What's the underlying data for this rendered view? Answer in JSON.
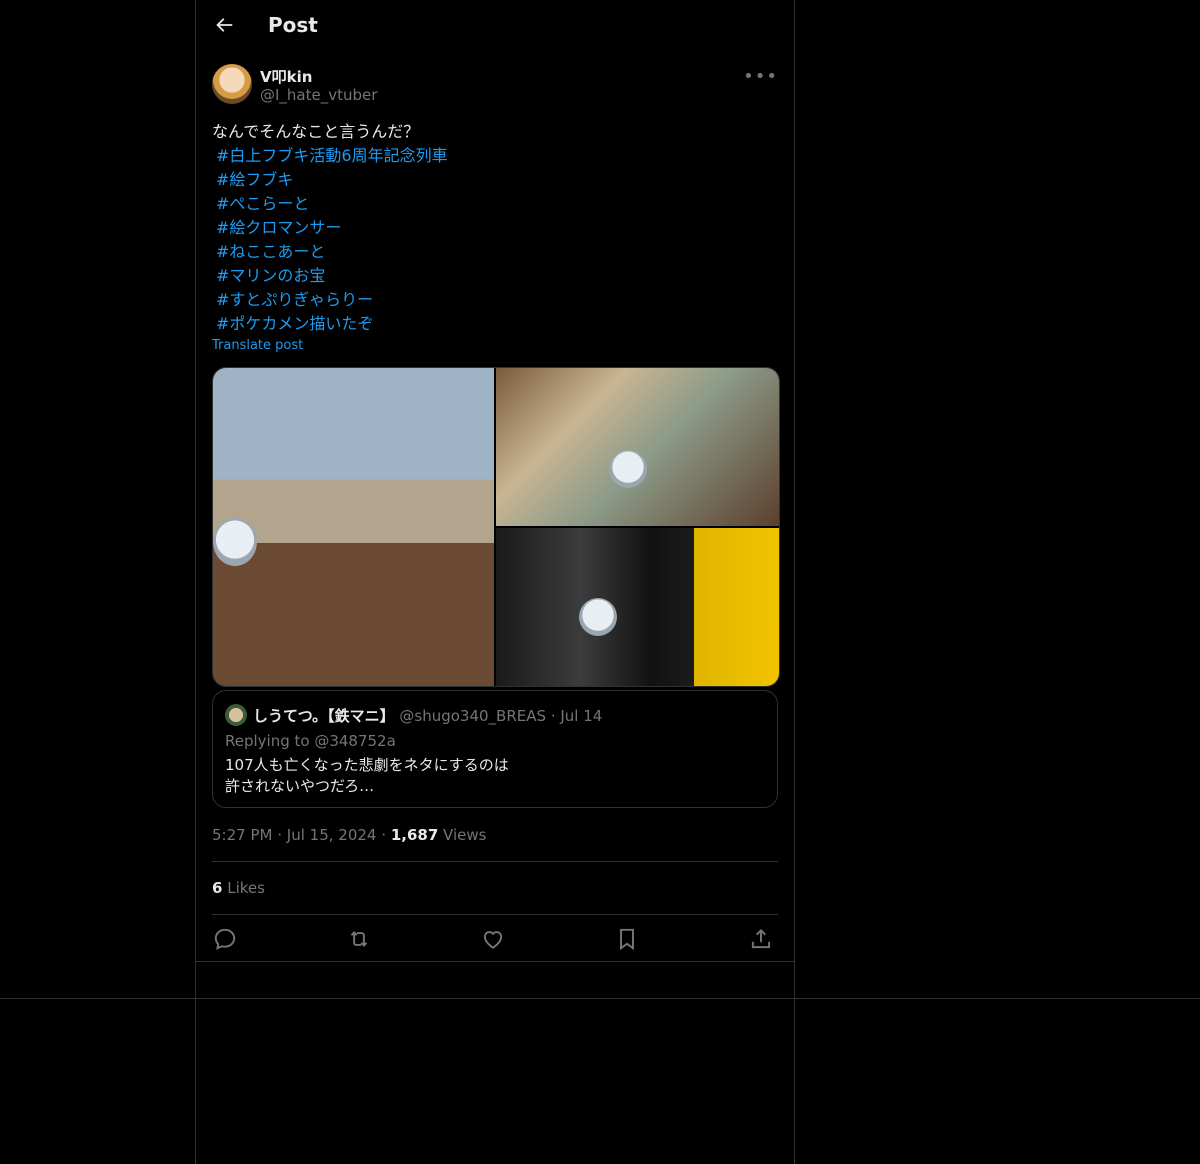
{
  "header": {
    "title": "Post",
    "back_icon": "arrow-left-icon"
  },
  "author": {
    "name": "V叩kin",
    "handle": "@I_hate_vtuber",
    "more_icon": "more-horizontal-icon"
  },
  "post": {
    "text": "なんでそんなこと言うんだ？",
    "hashtags": [
      "#白上フブキ活動6周年記念列車",
      "#絵フブキ",
      "#ぺこらーと",
      "#絵クロマンサー",
      "#ねここあーと",
      "#マリンのお宝",
      "#すとぷりぎゃらりー",
      "#ポケカメン描いたぞ"
    ],
    "translate_label": "Translate post"
  },
  "media": {
    "count": 3
  },
  "quote": {
    "name": "しうてつ。【鉄マニ】",
    "handle": "@shugo340_BREAS",
    "dot": "·",
    "date": "Jul 14",
    "replying_to": "Replying to @348752a",
    "text": "107人も亡くなった悲劇をネタにするのは\n許されないやつだろ…"
  },
  "meta": {
    "time": "5:27 PM",
    "dot1": "·",
    "date": "Jul 15, 2024",
    "dot2": "·",
    "views_count": "1,687",
    "views_label": "Views"
  },
  "engagement": {
    "likes_count": "6",
    "likes_label": "Likes"
  },
  "actions": [
    "reply-icon",
    "repost-icon",
    "like-icon",
    "bookmark-icon",
    "share-icon"
  ],
  "colors": {
    "accent": "#1d9bf0",
    "secondary": "#71767b",
    "border": "#2f3336",
    "text": "#e7e9ea"
  }
}
